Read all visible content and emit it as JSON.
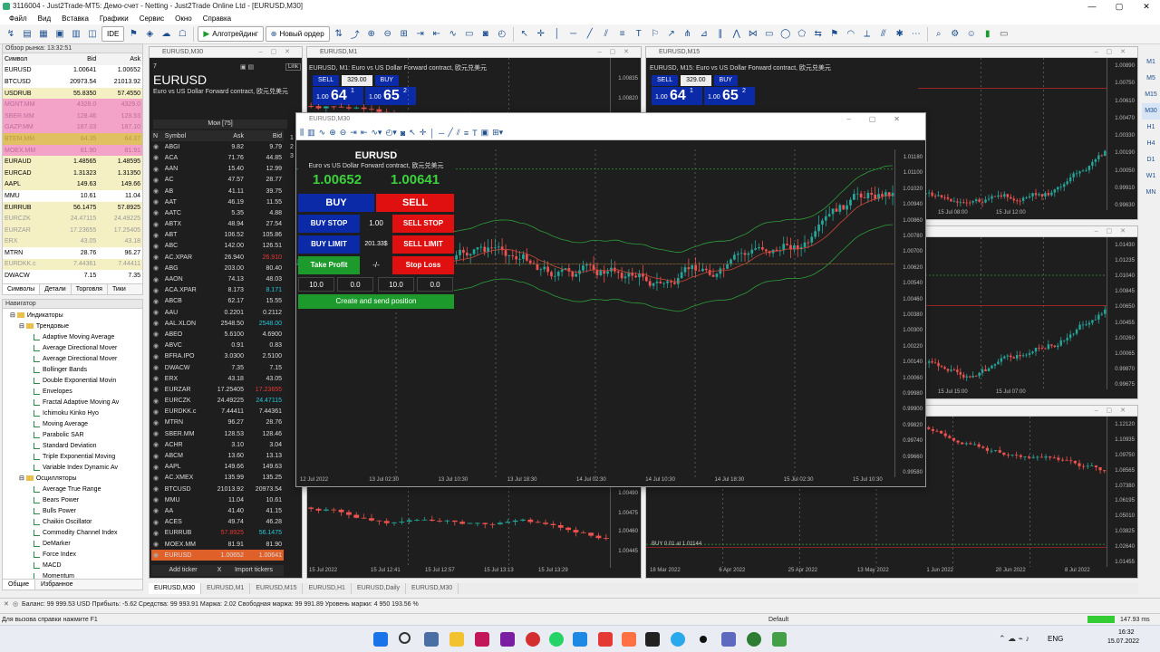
{
  "window": {
    "title": "3116004 - Just2Trade-MT5: Демо-счет - Netting - Just2Trade Online Ltd - [EURUSD,M30]"
  },
  "menu": [
    "Файл",
    "Вид",
    "Вставка",
    "Графики",
    "Сервис",
    "Окно",
    "Справка"
  ],
  "toolbar": {
    "algo_label": "Алготрейдинг",
    "new_order_label": "Новый ордер",
    "ide_label": "IDE"
  },
  "market_watch": {
    "title": "Обзор рынка: 13:32:51",
    "columns": [
      "Символ",
      "Bid",
      "Ask"
    ],
    "rows": [
      {
        "s": "EURUSD",
        "b": "1.00641",
        "a": "1.00652",
        "bg": "#ffffff",
        "c": "#000"
      },
      {
        "s": "BTCUSD",
        "b": "20973.54",
        "a": "21013.92",
        "bg": "#ffffff",
        "c": "#000"
      },
      {
        "s": "USDRUB",
        "b": "55.8350",
        "a": "57.4550",
        "bg": "#f5f0c4",
        "c": "#000"
      },
      {
        "s": "MGNT.MM",
        "b": "4328.0",
        "a": "4329.0",
        "bg": "#f3a3c7",
        "c": "#c06a9a"
      },
      {
        "s": "SBER.MM",
        "b": "128.46",
        "a": "128.53",
        "bg": "#f3a3c7",
        "c": "#c06a9a"
      },
      {
        "s": "GAZP.MM",
        "b": "187.03",
        "a": "187.10",
        "bg": "#f3a3c7",
        "c": "#c06a9a"
      },
      {
        "s": "BTEM.MM",
        "b": "64.35",
        "a": "64.37",
        "bg": "#e0c060",
        "c": "#b89a40"
      },
      {
        "s": "MOEX.MM",
        "b": "81.90",
        "a": "81.91",
        "bg": "#f3a3c7",
        "c": "#c06a9a"
      },
      {
        "s": "EURAUD",
        "b": "1.48565",
        "a": "1.48595",
        "bg": "#f5f0c4",
        "c": "#000"
      },
      {
        "s": "EURCAD",
        "b": "1.31323",
        "a": "1.31350",
        "bg": "#f5f0c4",
        "c": "#000"
      },
      {
        "s": "AAPL",
        "b": "149.63",
        "a": "149.66",
        "bg": "#f5f0c4",
        "c": "#000"
      },
      {
        "s": "MMU",
        "b": "10.61",
        "a": "11.04",
        "bg": "#ffffff",
        "c": "#000"
      },
      {
        "s": "EURRUB",
        "b": "56.1475",
        "a": "57.8925",
        "bg": "#f5f0c4",
        "c": "#000"
      },
      {
        "s": "EURCZK",
        "b": "24.47115",
        "a": "24.49225",
        "bg": "#f5f0c4",
        "c": "#999"
      },
      {
        "s": "EURZAR",
        "b": "17.23655",
        "a": "17.25405",
        "bg": "#f5f0c4",
        "c": "#999"
      },
      {
        "s": "ERX",
        "b": "43.05",
        "a": "43.18",
        "bg": "#f5f0c4",
        "c": "#999"
      },
      {
        "s": "MTRN",
        "b": "28.76",
        "a": "96.27",
        "bg": "#ffffff",
        "c": "#000"
      },
      {
        "s": "EURDKK.c",
        "b": "7.44361",
        "a": "7.44411",
        "bg": "#f5f0c4",
        "c": "#999"
      },
      {
        "s": "DWACW",
        "b": "7.15",
        "a": "7.35",
        "bg": "#ffffff",
        "c": "#000"
      }
    ],
    "tabs": [
      "Символы",
      "Детали",
      "Торговля",
      "Тики"
    ]
  },
  "navigator": {
    "title": "Навигатор",
    "indicators_label": "Индикаторы",
    "trend_label": "Трендовые",
    "trend": [
      "Adaptive Moving Average",
      "Average Directional Mover",
      "Average Directional Mover",
      "Bollinger Bands",
      "Double Exponential Movin",
      "Envelopes",
      "Fractal Adaptive Moving Av",
      "Ichimoku Kinko Hyo",
      "Moving Average",
      "Parabolic SAR",
      "Standard Deviation",
      "Triple Exponential Moving",
      "Variable Index Dynamic Av"
    ],
    "osc_label": "Осцилляторы",
    "osc": [
      "Average True Range",
      "Bears Power",
      "Bulls Power",
      "Chaikin Oscillator",
      "Commodity Channel Index",
      "DeMarker",
      "Force Index",
      "MACD",
      "Momentum"
    ],
    "tabs": [
      "Общие",
      "Избранное"
    ]
  },
  "w_left": {
    "title": "EURUSD,M30",
    "num": "7",
    "symbol": "EURUSD",
    "desc": "Euro vs US Dollar Forward contract, 欧元兑美元",
    "link": "Link",
    "tab": "Мои [75]",
    "columns": [
      "N",
      "Symbol",
      "Ask",
      "Bid"
    ],
    "rows": [
      [
        "ABGI",
        "9.82",
        "9.79"
      ],
      [
        "ACA",
        "71.76",
        "44.85"
      ],
      [
        "AAN",
        "15.40",
        "12.99"
      ],
      [
        "AC",
        "47.57",
        "28.77"
      ],
      [
        "AB",
        "41.11",
        "39.75"
      ],
      [
        "AAT",
        "46.19",
        "11.55"
      ],
      [
        "AATC",
        "5.35",
        "4.88"
      ],
      [
        "ABTX",
        "48.94",
        "27.54"
      ],
      [
        "ABT",
        "106.52",
        "105.86"
      ],
      [
        "ABC",
        "142.00",
        "126.51"
      ],
      [
        "AC.XPAR",
        "26.940",
        "26.910"
      ],
      [
        "ABG",
        "203.00",
        "80.40"
      ],
      [
        "AAON",
        "74.13",
        "48.03"
      ],
      [
        "ACA.XPAR",
        "8.173",
        "8.171"
      ],
      [
        "ABCB",
        "62.17",
        "15.55"
      ],
      [
        "AAU",
        "0.2201",
        "0.2112"
      ],
      [
        "AAL.XLON",
        "2548.50",
        "2548.00"
      ],
      [
        "ABEO",
        "5.6100",
        "4.6900"
      ],
      [
        "ABVC",
        "0.91",
        "0.83"
      ],
      [
        "BFRA.IPO",
        "3.0300",
        "2.5100"
      ],
      [
        "DWACW",
        "7.35",
        "7.15"
      ],
      [
        "ERX",
        "43.18",
        "43.05"
      ],
      [
        "EURZAR",
        "17.25405",
        "17.23655"
      ],
      [
        "EURCZK",
        "24.49225",
        "24.47115"
      ],
      [
        "EURDKK.c",
        "7.44411",
        "7.44361"
      ],
      [
        "MTRN",
        "96.27",
        "28.76"
      ],
      [
        "SBER.MM",
        "128.53",
        "128.46"
      ],
      [
        "ACHR",
        "3.10",
        "3.04"
      ],
      [
        "ABCM",
        "13.60",
        "13.13"
      ],
      [
        "AAPL",
        "149.66",
        "149.63"
      ],
      [
        "AC.XMEX",
        "135.99",
        "135.25"
      ],
      [
        "BTCUSD",
        "21013.92",
        "20973.54"
      ],
      [
        "MMU",
        "11.04",
        "10.61"
      ],
      [
        "AA",
        "41.40",
        "41.15"
      ],
      [
        "ACES",
        "49.74",
        "46.28"
      ],
      [
        "EURRUB",
        "57.8925",
        "56.1475"
      ],
      [
        "MOEX.MM",
        "81.91",
        "81.90"
      ],
      [
        "EURUSD",
        "1.00652",
        "1.00641"
      ]
    ],
    "add": "Add ticker",
    "x": "X",
    "import": "Import tickers"
  },
  "w_m1": {
    "title": "EURUSD,M1",
    "bar": "EURUSD, M1: Euro vs US Dollar Forward contract, 欧元兑美元",
    "sell": "SELL",
    "buy": "BUY",
    "vol": "329.00",
    "bid": "64",
    "bid_pre": "1.00",
    "bid_sup": "1",
    "ask": "65",
    "ask_pre": "1.00",
    "ask_sup": "2",
    "prices": [
      "1.00835",
      "1.00820"
    ],
    "lower_prices": [
      "1.00490",
      "1.00475",
      "1.00460",
      "1.00445"
    ],
    "times": [
      "15 Jul 2022",
      "15 Jul 12:41",
      "15 Jul 12:57",
      "15 Jul 13:13",
      "15 Jul 13:29"
    ]
  },
  "w_m15": {
    "title": "EURUSD,M15",
    "bar": "EURUSD, M15: Euro vs US Dollar Forward contract, 欧元兑美元",
    "sell": "SELL",
    "buy": "BUY",
    "vol": "329.00",
    "bid": "64",
    "bid_pre": "1.00",
    "bid_sup": "1",
    "ask": "65",
    "ask_pre": "1.00",
    "ask_sup": "2",
    "prices": [
      "1.00890",
      "1.00750",
      "1.00610",
      "1.00470",
      "1.00330",
      "1.00190",
      "1.00050",
      "0.99910",
      "0.99630"
    ],
    "times": [
      "15 Jul 08:00",
      "15 Jul 12:00"
    ],
    "sides": [
      "M1",
      "M5",
      "M15",
      "M30",
      "H1",
      "H4",
      "D1",
      "W1",
      "MN"
    ]
  },
  "w_h1": {
    "prices": [
      "1.01430",
      "1.01235",
      "1.01040",
      "1.00845",
      "1.00650",
      "1.00455",
      "1.00260",
      "1.00065",
      "0.99870",
      "0.99675"
    ],
    "times": [
      "15 Jul 15:00",
      "15 Jul 07:00"
    ]
  },
  "w_daily": {
    "prices": [
      "1.12120",
      "1.10935",
      "1.09750",
      "1.08565",
      "1.07380",
      "1.06195",
      "1.05010",
      "1.03825",
      "1.02640",
      "1.01455"
    ],
    "times": [
      "18 Mar 2022",
      "6 Apr 2022",
      "25 Apr 2022",
      "13 May 2022",
      "1 Jun 2022",
      "20 Jun 2022",
      "8 Jul 2022"
    ],
    "order": "BUY 0.01 at 1.01144"
  },
  "w_main": {
    "title": "EURUSD,M30",
    "symbol": "EURUSD",
    "desc": "Euro vs US Dollar Forward contract, 欧元兑美元",
    "bid": "1.00652",
    "ask": "1.00641",
    "buy": "BUY",
    "sell": "SELL",
    "buy_stop": "BUY STOP",
    "sell_stop": "SELL STOP",
    "buy_limit": "BUY LIMIT",
    "sell_limit": "SELL LIMIT",
    "take_profit": "Take Profit",
    "stop_loss": "Stop Loss",
    "lot": "1.00",
    "limit_price": "201.33$",
    "tp_sl": "-/-",
    "f1": "10.0",
    "f2": "0.0",
    "f3": "10.0",
    "f4": "0.0",
    "create": "Create and send position",
    "prices": [
      "1.01180",
      "1.01100",
      "1.01020",
      "1.00940",
      "1.00860",
      "1.00780",
      "1.00700",
      "1.00620",
      "1.00540",
      "1.00460",
      "1.00380",
      "1.00300",
      "1.00220",
      "1.00140",
      "1.00060",
      "0.99980",
      "0.99900",
      "0.99820",
      "0.99740",
      "0.99660",
      "0.99580"
    ],
    "times": [
      "12 Jul 2022",
      "13 Jul 02:30",
      "13 Jul 10:30",
      "13 Jul 18:30",
      "14 Jul 02:30",
      "14 Jul 10:30",
      "14 Jul 18:30",
      "15 Jul 02:30",
      "15 Jul 10:30"
    ]
  },
  "chart_tabs": [
    "EURUSD,M30",
    "EURUSD,M1",
    "EURUSD,M15",
    "EURUSD,H1",
    "EURUSD,Daily",
    "EURUSD,M30"
  ],
  "status": {
    "balance": "Баланс: 99 999.53 USD  Прибыль: -5.62  Средства: 99 993.91  Маржа: 2.02  Свободная маржа: 99 991.89  Уровень маржи: 4 950 193.56 %",
    "help": "Для вызова справки нажмите F1",
    "profile": "Default",
    "ping": "147.93 ms"
  },
  "taskbar": {
    "lang": "ENG",
    "time": "16:32",
    "date": "15.07.2022"
  },
  "colors": {
    "bull": "#26a69a",
    "bear": "#ef5350",
    "sell_red": "#e01010",
    "buy_blue": "#0b2aa8",
    "green": "#1c9a2c"
  }
}
